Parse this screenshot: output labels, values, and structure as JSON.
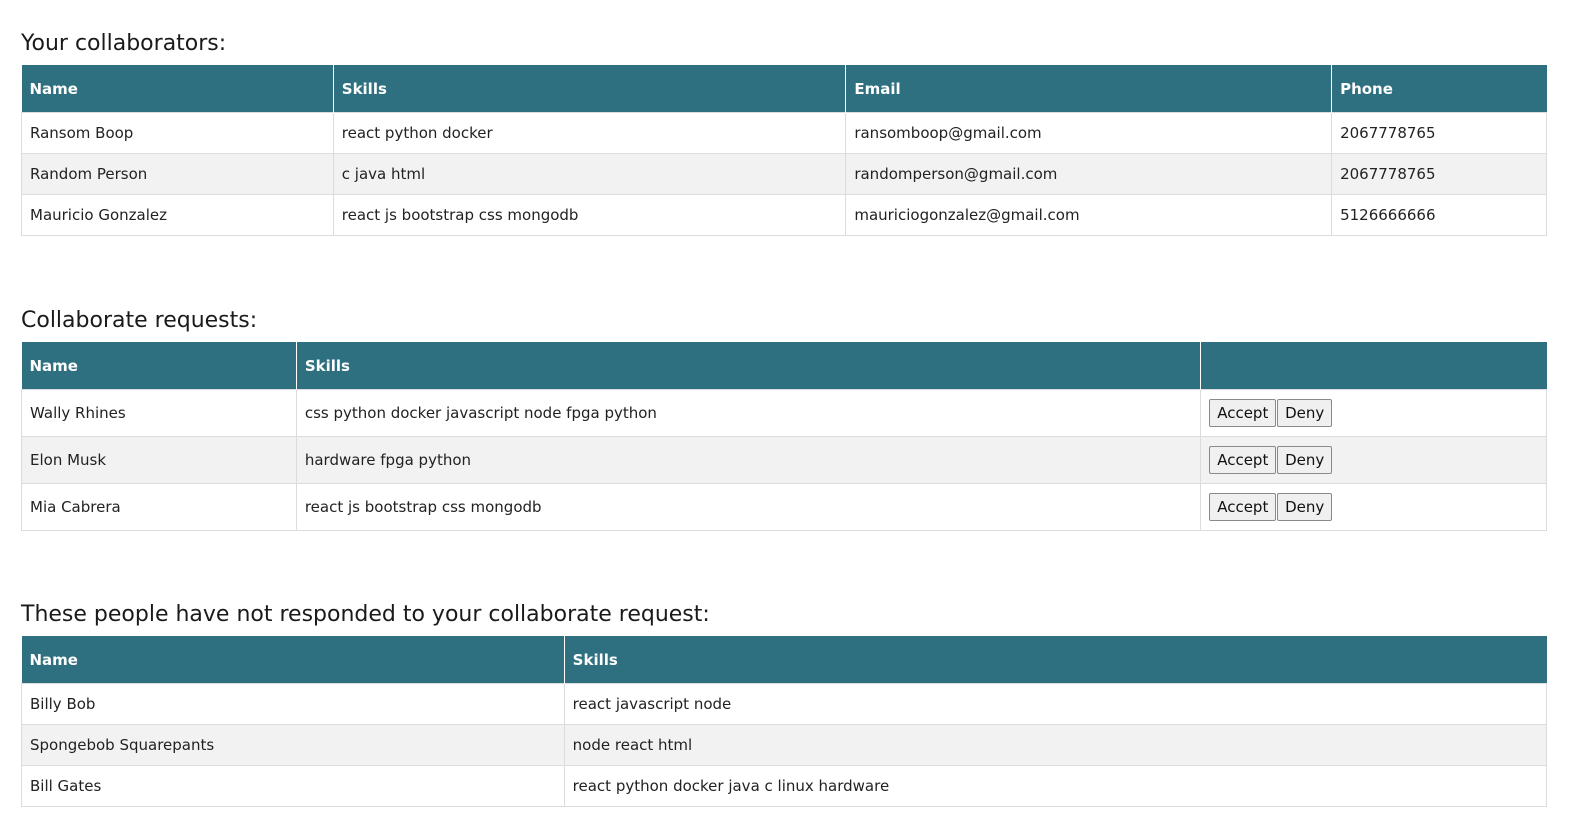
{
  "collaborators": {
    "heading": "Your collaborators:",
    "columns": [
      "Name",
      "Skills",
      "Email",
      "Phone"
    ],
    "rows": [
      {
        "name": "Ransom Boop",
        "skills": "react python docker",
        "email": "ransomboop@gmail.com",
        "phone": "2067778765"
      },
      {
        "name": "Random Person",
        "skills": "c java html",
        "email": "randomperson@gmail.com",
        "phone": "2067778765"
      },
      {
        "name": "Mauricio Gonzalez",
        "skills": "react js bootstrap css mongodb",
        "email": "mauriciogonzalez@gmail.com",
        "phone": "5126666666"
      }
    ]
  },
  "requests": {
    "heading": "Collaborate requests:",
    "columns": [
      "Name",
      "Skills",
      ""
    ],
    "accept_label": "Accept",
    "deny_label": "Deny",
    "rows": [
      {
        "name": "Wally Rhines",
        "skills": "css python docker javascript node fpga python"
      },
      {
        "name": "Elon Musk",
        "skills": "hardware fpga python"
      },
      {
        "name": "Mia Cabrera",
        "skills": "react js bootstrap css mongodb"
      }
    ]
  },
  "pending": {
    "heading": "These people have not responded to your collaborate request:",
    "columns": [
      "Name",
      "Skills"
    ],
    "rows": [
      {
        "name": "Billy Bob",
        "skills": "react javascript node"
      },
      {
        "name": "Spongebob Squarepants",
        "skills": "node react html"
      },
      {
        "name": "Bill Gates",
        "skills": "react python docker java c linux hardware"
      }
    ]
  },
  "theme": {
    "header_bg": "#2e7080",
    "header_text": "#ffffff",
    "alt_row_bg": "#f2f2f2"
  }
}
